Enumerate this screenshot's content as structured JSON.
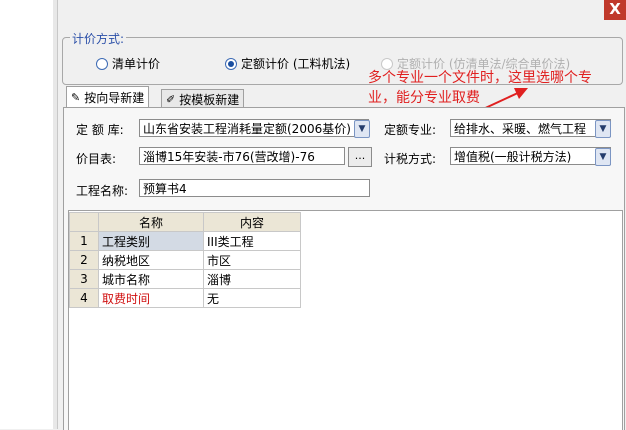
{
  "window": {
    "close_label": "X"
  },
  "pricing_group": {
    "legend": "计价方式:",
    "options": [
      {
        "label": "清单计价",
        "selected": false,
        "enabled": true
      },
      {
        "label": "定额计价 (工料机法)",
        "selected": true,
        "enabled": true
      },
      {
        "label": "定额计价 (仿清单法/综合单价法)",
        "selected": false,
        "enabled": false
      }
    ]
  },
  "annotation": {
    "line1": "多个专业一个文件时，这里选哪个专",
    "line2": "业，能分专业取费",
    "color": "#e02020"
  },
  "tabs": [
    {
      "label": "按向导新建",
      "active": true,
      "icon": "wizard-icon"
    },
    {
      "label": "按模板新建",
      "active": false,
      "icon": "template-icon"
    }
  ],
  "form": {
    "quota_lib_label": "定 额 库:",
    "quota_lib_value": "山东省安装工程消耗量定额(2006基价)",
    "quota_major_label": "定额专业:",
    "quota_major_value": "给排水、采暖、燃气工程",
    "price_table_label": "价目表:",
    "price_table_value": "淄博15年安装-市76(营改增)-76",
    "browse_label": "...",
    "tax_method_label": "计税方式:",
    "tax_method_value": "增值税(一般计税方法)",
    "project_name_label": "工程名称:",
    "project_name_value": "预算书4"
  },
  "grid": {
    "headers": [
      "名称",
      "内容"
    ],
    "rows": [
      {
        "no": "1",
        "name": "工程类别",
        "value": "III类工程",
        "highlight": false
      },
      {
        "no": "2",
        "name": "纳税地区",
        "value": "市区",
        "highlight": false
      },
      {
        "no": "3",
        "name": "城市名称",
        "value": "淄博",
        "highlight": false
      },
      {
        "no": "4",
        "name": "取费时间",
        "value": "无",
        "highlight": true
      }
    ]
  }
}
